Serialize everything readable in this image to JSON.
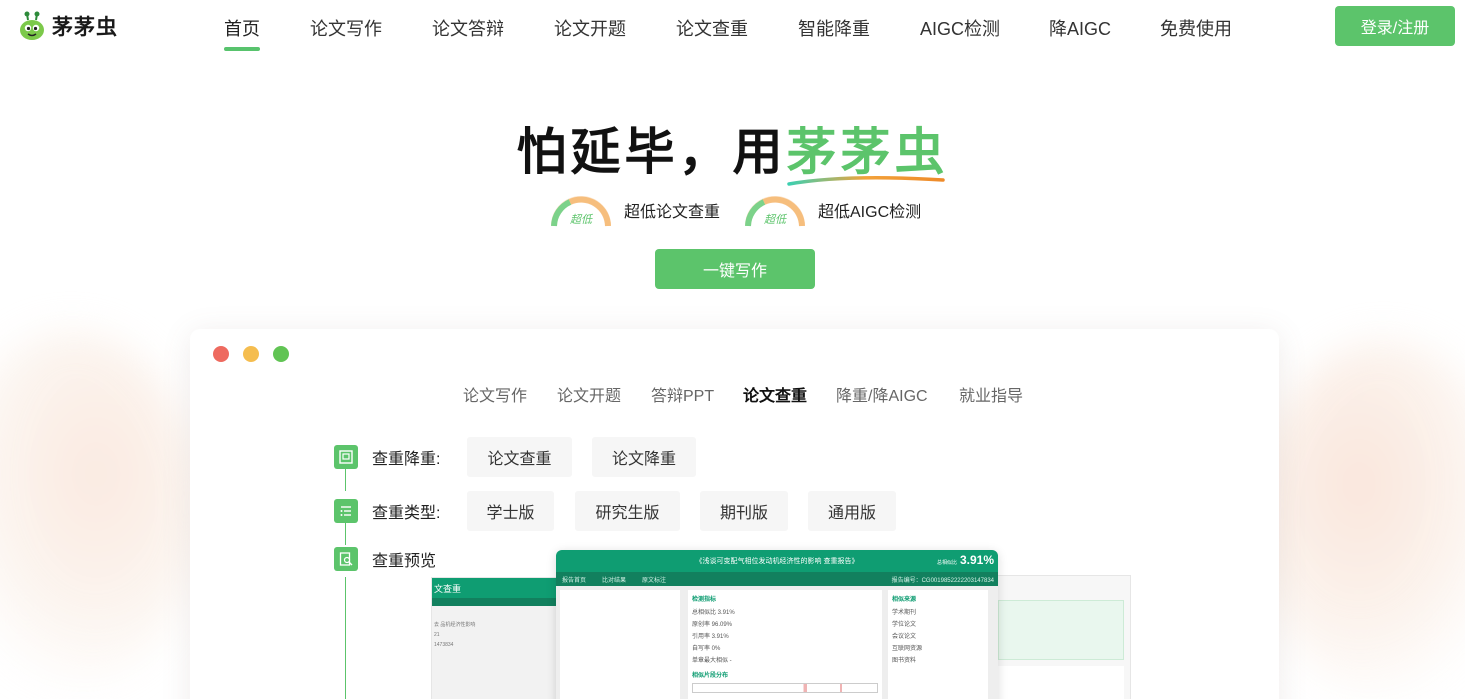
{
  "header": {
    "logo_text": "茅茅虫",
    "nav": [
      {
        "label": "首页",
        "active": true
      },
      {
        "label": "论文写作"
      },
      {
        "label": "论文答辩"
      },
      {
        "label": "论文开题"
      },
      {
        "label": "论文查重"
      },
      {
        "label": "智能降重"
      },
      {
        "label": "AIGC检测"
      },
      {
        "label": "降AIGC"
      },
      {
        "label": "免费使用"
      }
    ],
    "login_label": "登录/注册"
  },
  "hero": {
    "title_prefix": "怕延毕，用",
    "title_brand": "茅茅虫",
    "features": [
      {
        "gauge_label": "超低",
        "text": "超低论文查重"
      },
      {
        "gauge_label": "超低",
        "text": "超低AIGC检测"
      }
    ],
    "cta_label": "一键写作"
  },
  "window": {
    "tabs": [
      {
        "label": "论文写作"
      },
      {
        "label": "论文开题"
      },
      {
        "label": "答辩PPT"
      },
      {
        "label": "论文查重",
        "active": true
      },
      {
        "label": "降重/降AIGC"
      },
      {
        "label": "就业指导"
      }
    ],
    "rows": {
      "r1": {
        "label": "查重降重:",
        "options": [
          "论文查重",
          "论文降重"
        ]
      },
      "r2": {
        "label": "查重类型:",
        "options": [
          "学士版",
          "研究生版",
          "期刊版",
          "通用版"
        ]
      },
      "r3": {
        "label": "查重预览"
      }
    },
    "preview": {
      "left_title": "文查重",
      "main_title": "《浅谈可变配气相位发动机经济性的影响 查重报告》",
      "percent": "3.91%",
      "percent_prefix": "总相似比",
      "sub_items": [
        "报告首页",
        "比对结果",
        "原文标注"
      ],
      "report_no": "报告编号：CG0019852222203147834",
      "card1_title": "检测指标",
      "card1_lines": [
        "总相似比     3.91%",
        "原创率       96.09%",
        "引用率       3.91%",
        "自写率       0%",
        "单章最大相似  -"
      ],
      "card2_title": "相似片段分布",
      "card3_title": "相似来源",
      "card3_lines": [
        "学术期刊",
        "学位论文",
        "会议论文",
        "互联网资源",
        "图书资料"
      ],
      "left_lines": [
        "去 品机经济性影响",
        "21",
        "1473834"
      ]
    }
  },
  "colors": {
    "accent": "#5cc46b",
    "report_green": "#0f9d72"
  }
}
